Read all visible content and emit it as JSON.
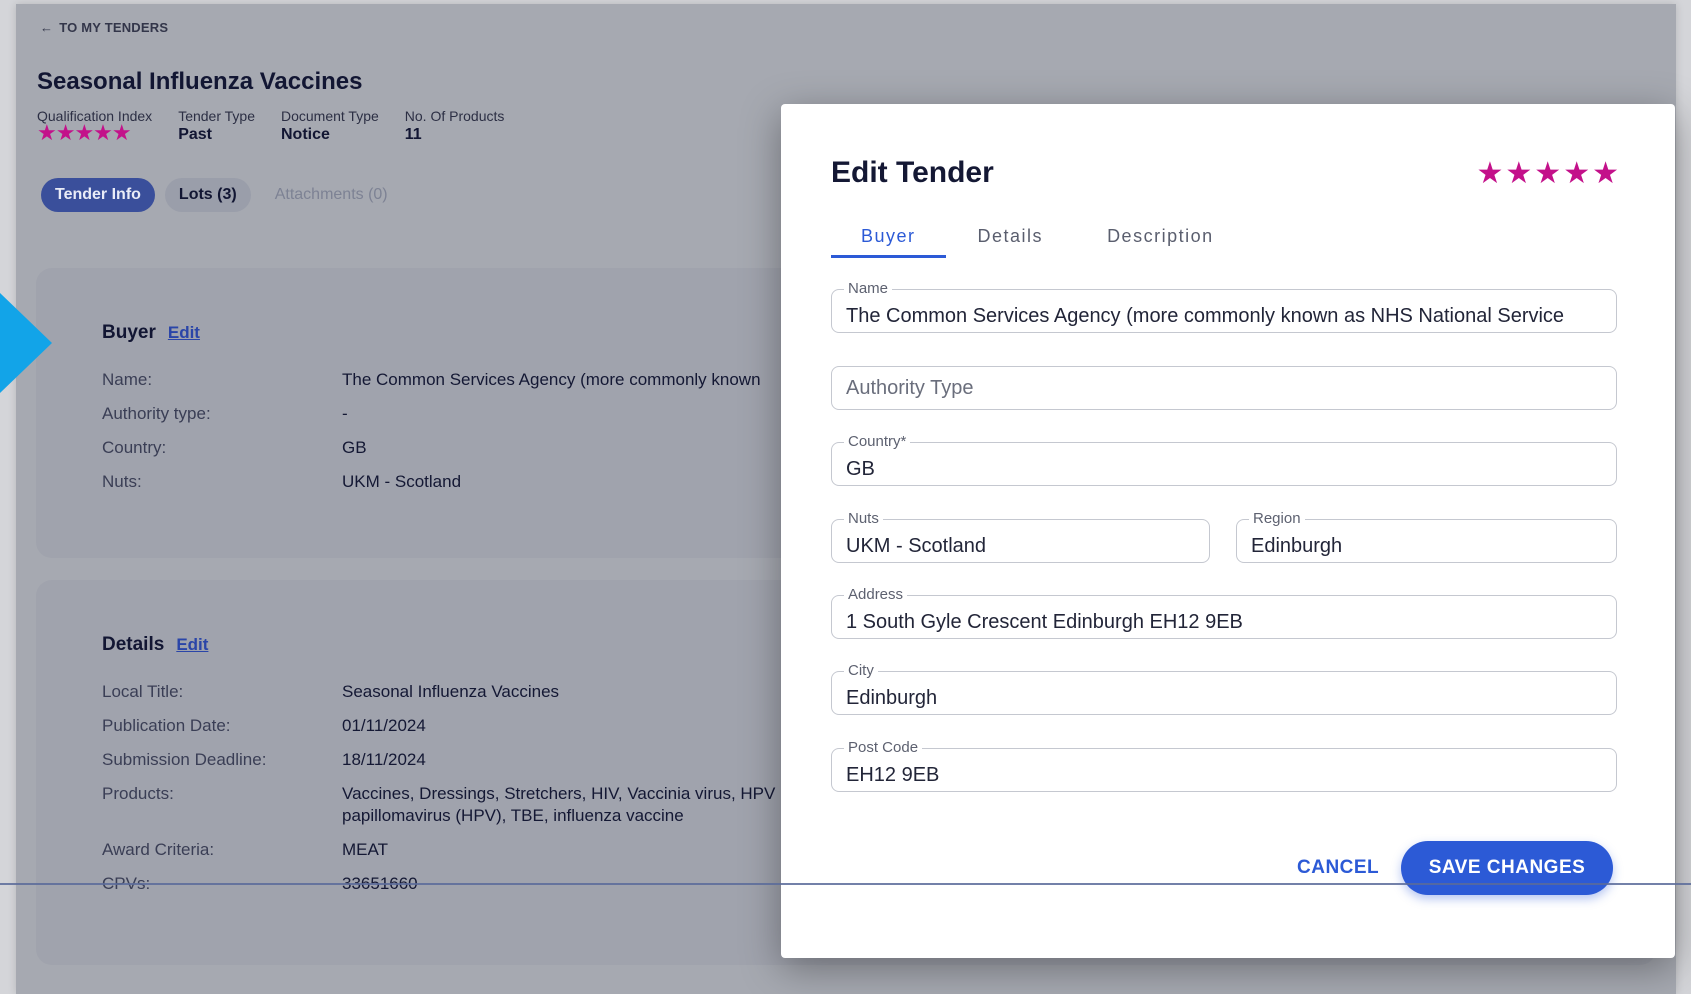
{
  "nav": {
    "back_label": "TO MY TENDERS",
    "back_icon": "arrow-left-icon"
  },
  "tender": {
    "title": "Seasonal Influenza Vaccines",
    "meta": [
      {
        "label": "Qualification Index",
        "value": "★★★★★"
      },
      {
        "label": "Tender Type",
        "value": "Past"
      },
      {
        "label": "Document Type",
        "value": "Notice"
      },
      {
        "label": "No. Of Products",
        "value": "11"
      }
    ]
  },
  "tabs": [
    {
      "label": "Tender Info",
      "active": true
    },
    {
      "label": "Lots (3)"
    },
    {
      "label": "Attachments (0)"
    }
  ],
  "buyer": {
    "heading": "Buyer",
    "edit_label": "Edit",
    "rows": [
      {
        "key": "Name:",
        "value": "The Common Services Agency (more commonly known"
      },
      {
        "key": "Authority type:",
        "value": "-"
      },
      {
        "key": "Country:",
        "value": "GB"
      },
      {
        "key": "Nuts:",
        "value": "UKM - Scotland"
      }
    ]
  },
  "details": {
    "heading": "Details",
    "edit_label": "Edit",
    "rows": [
      {
        "key": "Local Title:",
        "value": "Seasonal Influenza Vaccines"
      },
      {
        "key": "Publication Date:",
        "value": "01/11/2024"
      },
      {
        "key": "Submission Deadline:",
        "value": "18/11/2024"
      },
      {
        "key": "Products:",
        "value": "Vaccines, Dressings, Stretchers, HIV, Vaccinia virus, HPV",
        "value2": "papillomavirus (HPV), TBE, influenza vaccine"
      },
      {
        "key": "Award Criteria:",
        "value": "MEAT"
      },
      {
        "key": "CPVs:",
        "value": "33651660"
      }
    ]
  },
  "modal": {
    "title": "Edit Tender",
    "stars": "★★★★★",
    "tabs": [
      {
        "label": "Buyer",
        "active": true
      },
      {
        "label": "Details"
      },
      {
        "label": "Description"
      }
    ],
    "fields": {
      "name": {
        "label": "Name",
        "value": "The Common Services Agency (more commonly known as NHS National Service"
      },
      "authority_type": {
        "placeholder": "Authority Type"
      },
      "country": {
        "label": "Country*",
        "value": "GB"
      },
      "nuts": {
        "label": "Nuts",
        "value": "UKM - Scotland"
      },
      "region": {
        "label": "Region",
        "value": "Edinburgh"
      },
      "address": {
        "label": "Address",
        "value": "1 South Gyle Crescent Edinburgh EH12 9EB"
      },
      "city": {
        "label": "City",
        "value": "Edinburgh"
      },
      "post_code": {
        "label": "Post Code",
        "value": "EH12 9EB"
      }
    },
    "cancel_label": "CANCEL",
    "save_label": "SAVE CHANGES"
  },
  "colors": {
    "accent": "#2c5ad6",
    "stars": "#c3118a",
    "pointer": "#12a4e8"
  }
}
